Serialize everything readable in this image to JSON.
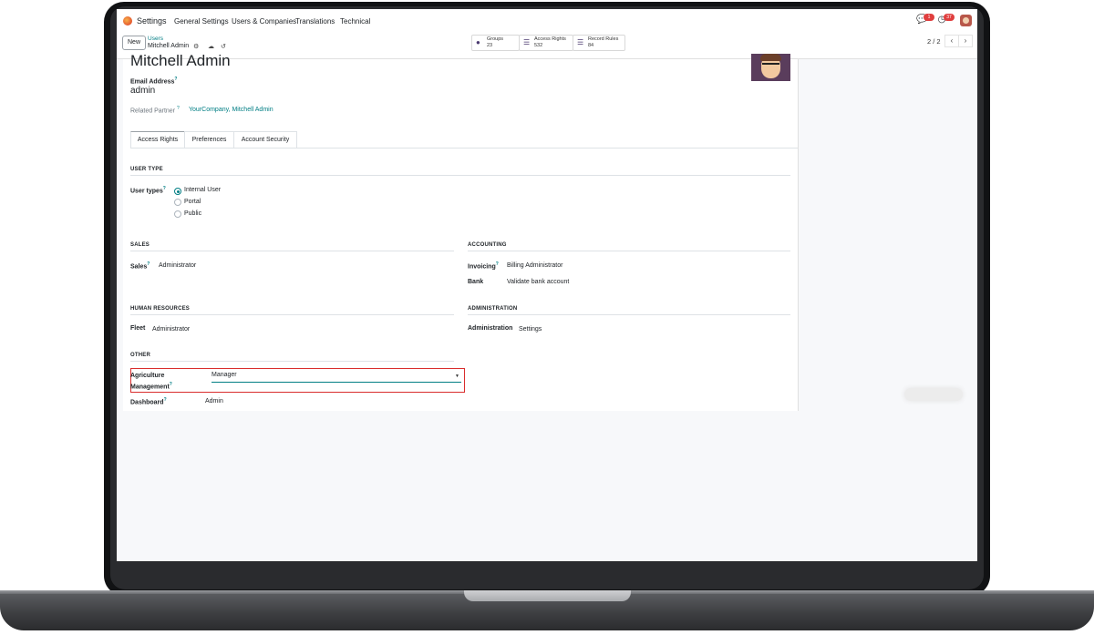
{
  "navbar": {
    "app_name": "Settings",
    "menus": [
      "General Settings",
      "Users & Companies",
      "Translations",
      "Technical"
    ],
    "messages_count": "1",
    "activities_count": "37"
  },
  "control_panel": {
    "new_label": "New",
    "breadcrumb_parent": "Users",
    "breadcrumb_current": "Mitchell Admin",
    "stats": [
      {
        "label": "Groups",
        "value": "23",
        "icon": "users-icon"
      },
      {
        "label": "Access Rights",
        "value": "532",
        "icon": "list-icon"
      },
      {
        "label": "Record Rules",
        "value": "84",
        "icon": "list-icon"
      }
    ],
    "pager": "2 / 2"
  },
  "form": {
    "name": "Mitchell Admin",
    "email_label": "Email Address",
    "email_value": "admin",
    "partner_label": "Related Partner",
    "partner_value": "YourCompany, Mitchell Admin",
    "tabs": [
      "Access Rights",
      "Preferences",
      "Account Security"
    ],
    "user_type_section": "USER TYPE",
    "user_types_label": "User types",
    "user_types": [
      "Internal User",
      "Portal",
      "Public"
    ],
    "user_type_selected": "Internal User",
    "sales_section": "SALES",
    "sales_label": "Sales",
    "sales_value": "Administrator",
    "accounting_section": "ACCOUNTING",
    "invoicing_label": "Invoicing",
    "invoicing_value": "Billing Administrator",
    "bank_label": "Bank",
    "bank_value": "Validate bank account",
    "hr_section": "HUMAN RESOURCES",
    "fleet_label": "Fleet",
    "fleet_value": "Administrator",
    "admin_section": "ADMINISTRATION",
    "administration_label": "Administration",
    "administration_value": "Settings",
    "other_section": "OTHER",
    "agri_label_line1": "Agriculture",
    "agri_label_line2": "Management",
    "agri_value": "Manager",
    "dashboard_label": "Dashboard",
    "dashboard_value": "Admin"
  },
  "colors": {
    "accent": "#017e84",
    "highlight": "#d92d2d"
  }
}
